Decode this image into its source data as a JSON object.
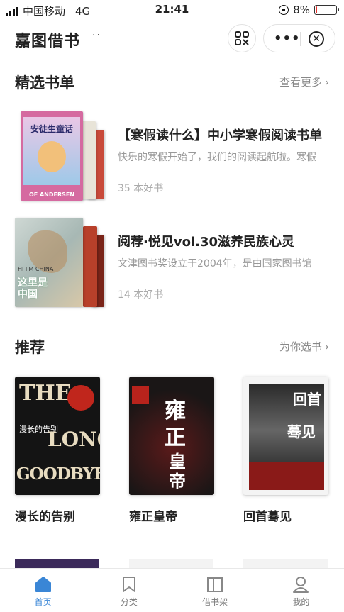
{
  "status_bar": {
    "carrier": "中国移动",
    "network": "4G",
    "time": "21:41",
    "battery_percent": "8%",
    "battery_level": 0.08,
    "battery_color": "#e5322d"
  },
  "navbar": {
    "title": "嘉图借书",
    "title_suffix": "··",
    "more_label": "•••"
  },
  "featured": {
    "heading": "精选书单",
    "more_link": "查看更多",
    "lists": [
      {
        "title": "【寒假读什么】中小学寒假阅读书单",
        "description": "快乐的寒假开始了，我们的阅读起航啦。寒假",
        "count": "35 本好书",
        "cover_text": "安徒生童话",
        "cover_subtext": "OF ANDERSEN"
      },
      {
        "title": "阅荐·悦见vol.30滋养民族心灵",
        "description": "文津图书奖设立于2004年，是由国家图书馆",
        "count": "14 本好书",
        "cover_text": "这里是中国",
        "cover_subtext": "HI I'M CHINA"
      }
    ]
  },
  "recommend": {
    "heading": "推荐",
    "more_link": "为你选书",
    "books": [
      {
        "title": "漫长的告别",
        "cover_lines": [
          "THE",
          "漫长的告别",
          "LONG",
          "GOODBYE"
        ]
      },
      {
        "title": "雍正皇帝",
        "cover_lines": [
          "雍正",
          "皇帝"
        ]
      },
      {
        "title": "回首蓦见",
        "cover_lines": [
          "回首",
          "蓦见"
        ]
      }
    ]
  },
  "tabbar": {
    "items": [
      {
        "label": "首页",
        "icon": "home-icon",
        "active": true
      },
      {
        "label": "分类",
        "icon": "bookmark-icon",
        "active": false
      },
      {
        "label": "借书架",
        "icon": "bookshelf-icon",
        "active": false
      },
      {
        "label": "我的",
        "icon": "user-icon",
        "active": false
      }
    ],
    "active_color": "#3a86d6"
  }
}
